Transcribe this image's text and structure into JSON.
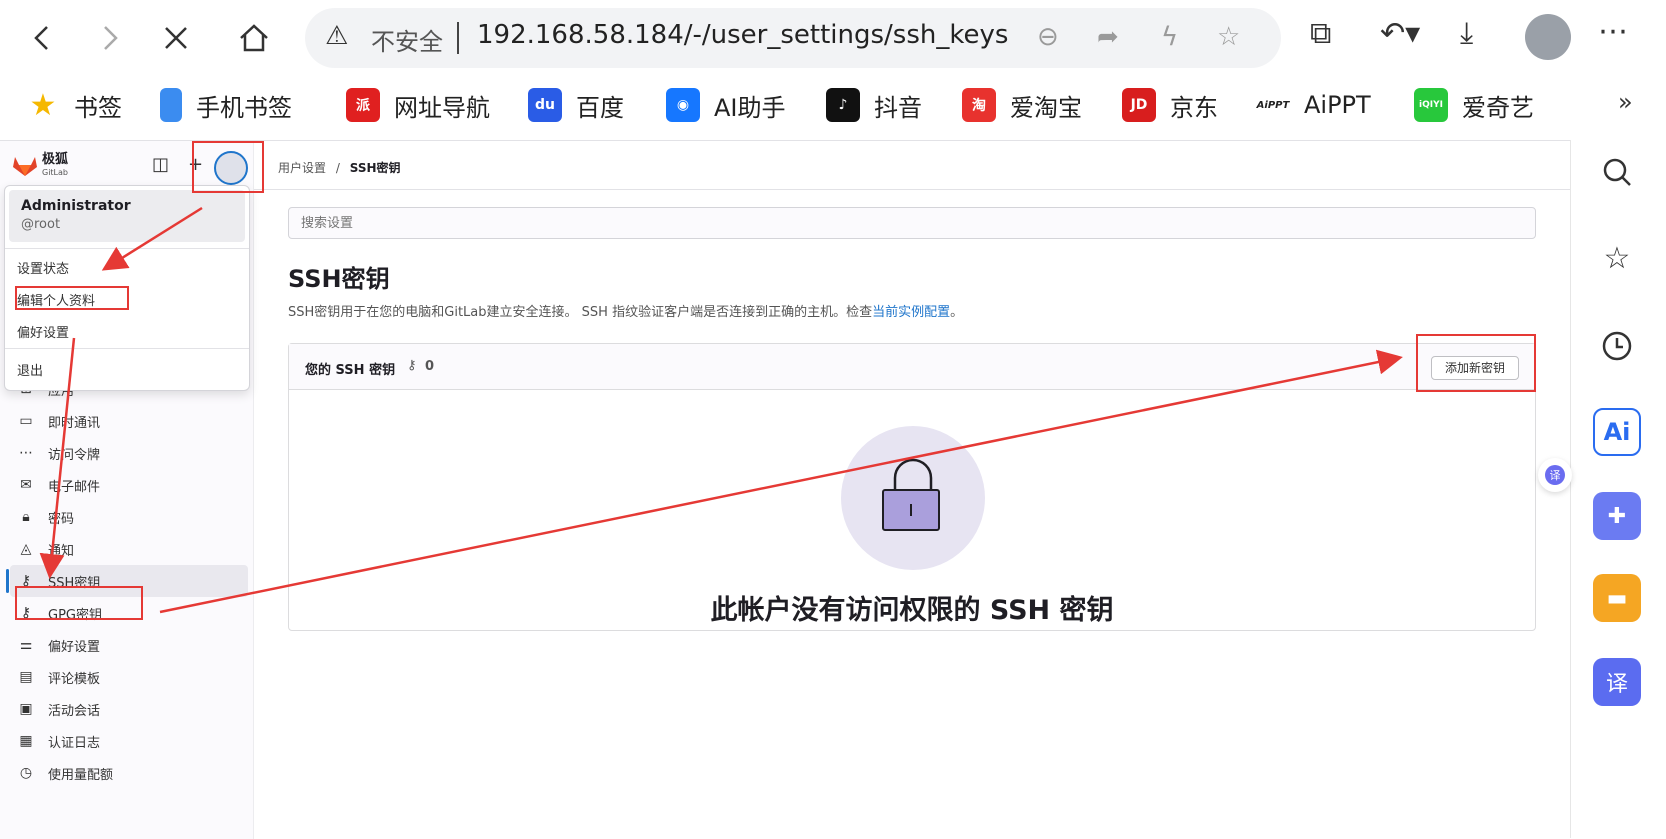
{
  "browser": {
    "address": {
      "insecure_label": "不安全",
      "url": "192.168.58.184/-/user_settings/ssh_keys"
    },
    "bookmarks": [
      {
        "label": "书签",
        "icon": "star-icon",
        "color": "#f5b800"
      },
      {
        "label": "手机书签",
        "icon": "phone-icon",
        "color": "#3b8cf0"
      },
      {
        "label": "网址导航",
        "icon": "nav-icon",
        "color": "#e02020"
      },
      {
        "label": "百度",
        "icon": "baidu-icon",
        "color": "#2a5ce6"
      },
      {
        "label": "AI助手",
        "icon": "ai-assistant-icon",
        "color": "#1677ff"
      },
      {
        "label": "抖音",
        "icon": "douyin-icon",
        "color": "#111111"
      },
      {
        "label": "爱淘宝",
        "icon": "taobao-icon",
        "color": "#e8322e"
      },
      {
        "label": "京东",
        "icon": "jd-icon",
        "color": "#d81e1e"
      },
      {
        "label": "AiPPT",
        "icon": "aippt-icon",
        "color": "#222222"
      },
      {
        "label": "爱奇艺",
        "icon": "iqiyi-icon",
        "color": "#28c83c"
      }
    ]
  },
  "gitlab": {
    "brand": "极狐",
    "brand_sub": "GitLab",
    "dropdown": {
      "name": "Administrator",
      "handle": "@root",
      "items": [
        "设置状态",
        "编辑个人资料",
        "偏好设置",
        "退出"
      ]
    },
    "nav": [
      {
        "label": "应用",
        "icon": "apps-icon"
      },
      {
        "label": "即时通讯",
        "icon": "chat-icon"
      },
      {
        "label": "访问令牌",
        "icon": "token-icon"
      },
      {
        "label": "电子邮件",
        "icon": "mail-icon"
      },
      {
        "label": "密码",
        "icon": "lock-icon"
      },
      {
        "label": "通知",
        "icon": "bell-icon"
      },
      {
        "label": "SSH密钥",
        "icon": "key-icon"
      },
      {
        "label": "GPG密钥",
        "icon": "key-icon"
      },
      {
        "label": "偏好设置",
        "icon": "preferences-icon"
      },
      {
        "label": "评论模板",
        "icon": "comment-template-icon"
      },
      {
        "label": "活动会话",
        "icon": "session-icon"
      },
      {
        "label": "认证日志",
        "icon": "log-icon"
      },
      {
        "label": "使用量配额",
        "icon": "quota-icon"
      }
    ],
    "breadcrumb": {
      "parent": "用户设置",
      "sep": "/",
      "current": "SSH密钥"
    },
    "search_placeholder": "搜索设置",
    "title": "SSH密钥",
    "description": "SSH密钥用于在您的电脑和GitLab建立安全连接。 SSH 指纹验证客户端是否连接到正确的主机。检查",
    "description_link": "当前实例配置",
    "description_end": "。",
    "card": {
      "title": "您的 SSH 密钥",
      "count": "0",
      "add_button": "添加新密钥",
      "empty_text": "此帐户没有访问权限的 SSH 密钥"
    }
  },
  "annotation_color": "#e53935"
}
